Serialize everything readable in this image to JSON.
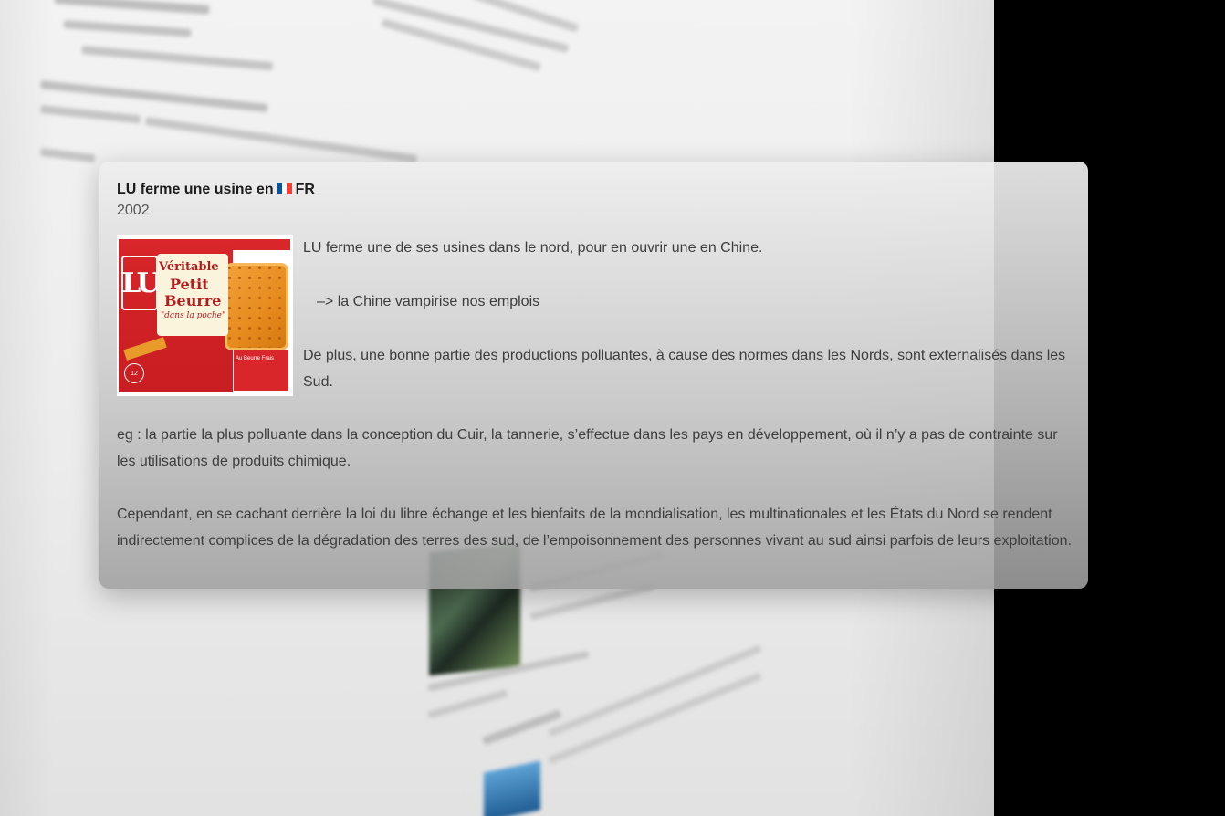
{
  "popup": {
    "title_prefix": "LU ferme une usine en",
    "country_code": "FR",
    "flag_colors": [
      "#0055A4",
      "#FFFFFF",
      "#EF4135"
    ],
    "year": "2002",
    "image": {
      "logo_text": "LU",
      "label_line1": "Véritable",
      "label_line2": "Petit",
      "label_line3": "Beurre",
      "label_script": "\"dans la poche\"",
      "side_text": "Au Beurre Frais",
      "count": "12"
    },
    "paragraph_intro": "LU ferme une de ses usines dans le nord, pour en ouvrir une en Chine.",
    "paragraph_arrow": "–> la Chine vampirise nos emplois",
    "paragraph_plus": "De plus, une bonne partie des productions polluantes, à cause des normes dans les Nords, sont externalisés dans les Sud.",
    "paragraph_eg": "eg : la partie la plus polluante dans la conception du Cuir, la tannerie, s’effectue dans les pays en développement, où il n’y a pas de contrainte sur les utilisations de produits chimique.",
    "paragraph_cependant": "Cependant, en se cachant derrière la loi du libre échange et les bienfaits de la mondialisation, les multinationales et les États du Nord se rendent indirectement complices de la dégradation des terres des sud, de l’empoisonnement des personnes vivant au sud ainsi parfois de leurs exploitation."
  }
}
